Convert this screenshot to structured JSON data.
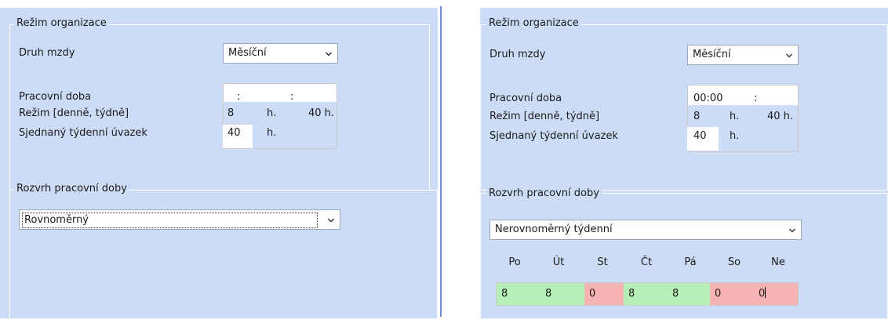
{
  "left": {
    "group_title": "Režim organizace",
    "druh_mzdy_label": "Druh mzdy",
    "druh_mzdy_value": "Měsíční",
    "pracovni_doba_label": "Pracovní doba",
    "pracovni_doba_from": ":",
    "pracovni_doba_to": ":",
    "rezim_label": "Režim [denně, týdně]",
    "rezim_daily": "8",
    "rezim_daily_unit": "h.",
    "rezim_weekly": "40 h.",
    "uvazek_label": "Sjednaný týdenní úvazek",
    "uvazek_value": "40",
    "uvazek_unit": "h.",
    "rozvrh_title": "Rozvrh pracovní doby",
    "rozvrh_value": "Rovnoměrný"
  },
  "right": {
    "group_title": "Režim organizace",
    "druh_mzdy_label": "Druh mzdy",
    "druh_mzdy_value": "Měsíční",
    "pracovni_doba_label": "Pracovní doba",
    "pracovni_doba_from": "00:00",
    "pracovni_doba_to": ":",
    "rezim_label": "Režim [denně, týdně]",
    "rezim_daily": "8",
    "rezim_daily_unit": "h.",
    "rezim_weekly": "40 h.",
    "uvazek_label": "Sjednaný týdenní úvazek",
    "uvazek_value": "40",
    "uvazek_unit": "h.",
    "rozvrh_title": "Rozvrh pracovní doby",
    "rozvrh_value": "Nerovnoměrný týdenní",
    "days": [
      {
        "label": "Po",
        "value": "8",
        "status": "green"
      },
      {
        "label": "Út",
        "value": "8",
        "status": "green"
      },
      {
        "label": "St",
        "value": "0",
        "status": "red"
      },
      {
        "label": "Čt",
        "value": "8",
        "status": "green"
      },
      {
        "label": "Pá",
        "value": "8",
        "status": "green"
      },
      {
        "label": "So",
        "value": "0",
        "status": "red"
      },
      {
        "label": "Ne",
        "value": "0",
        "status": "red"
      }
    ]
  },
  "colors": {
    "panel_bg": "#cddcf6",
    "divider": "#6f8fcf",
    "workday": "#b6f0b6",
    "dayoff": "#f6b3b3"
  },
  "icons": {
    "dropdown": "chevron-down-icon"
  }
}
